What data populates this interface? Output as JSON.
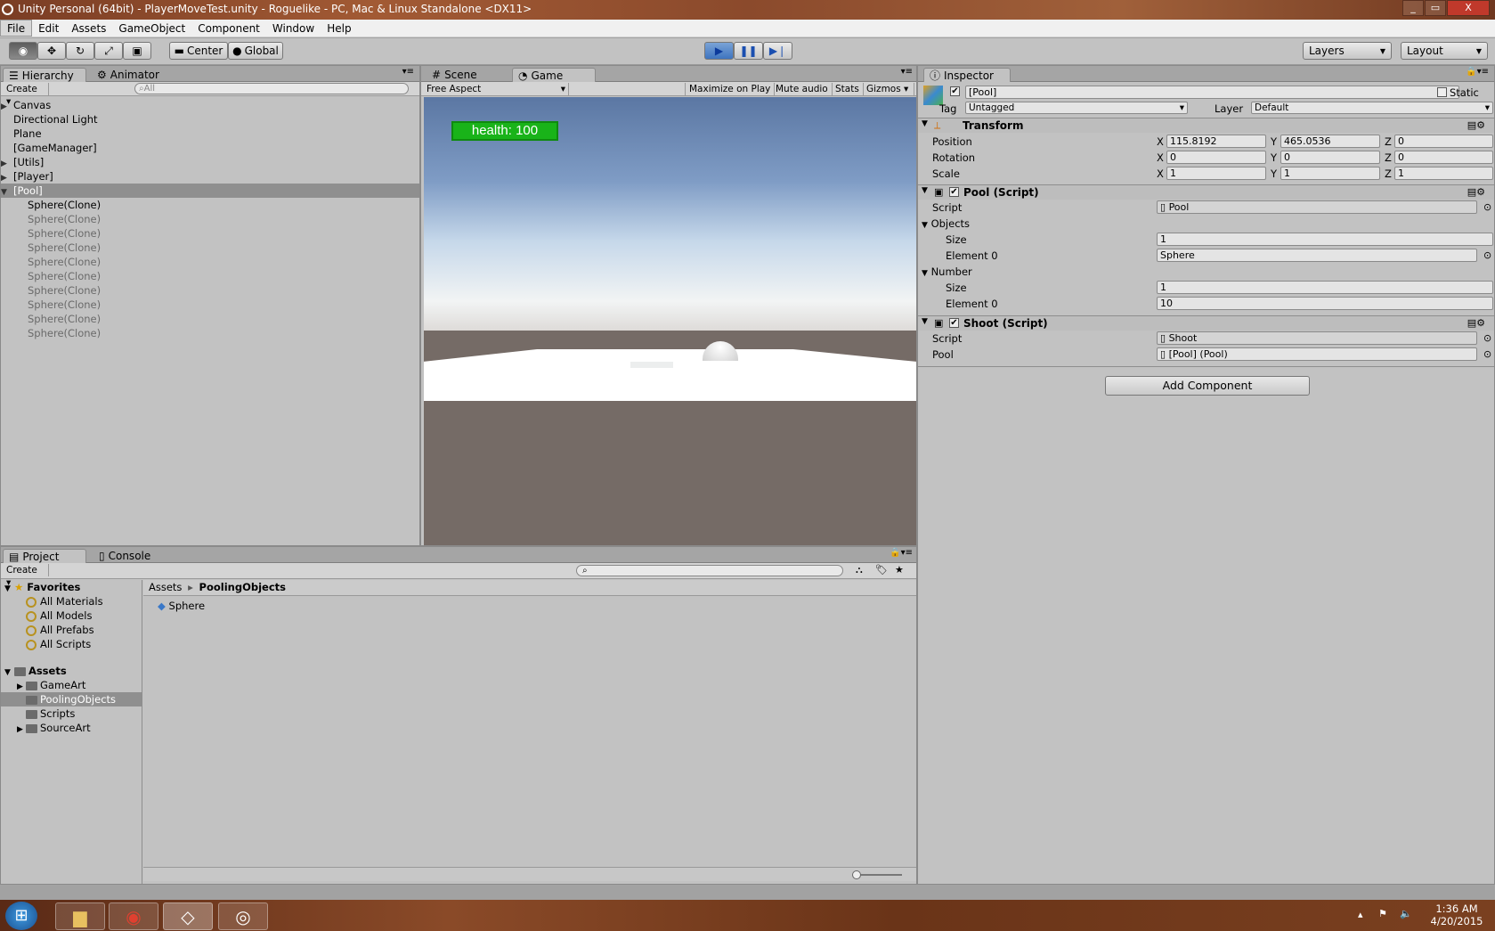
{
  "window": {
    "title": "Unity Personal (64bit) - PlayerMoveTest.unity - Roguelike - PC, Mac & Linux Standalone <DX11>",
    "minimize": "_",
    "maximize": "▭",
    "close": "X"
  },
  "menu": [
    "File",
    "Edit",
    "Assets",
    "GameObject",
    "Component",
    "Window",
    "Help"
  ],
  "toolbar": {
    "pivot": "Center",
    "space": "Global",
    "layers": "Layers",
    "layout": "Layout"
  },
  "hierarchy": {
    "tab": "Hierarchy",
    "tab2": "Animator",
    "create": "Create",
    "search_placeholder": "All",
    "items": [
      {
        "label": "Canvas",
        "expand": "▶"
      },
      {
        "label": "Directional Light",
        "expand": ""
      },
      {
        "label": "Plane",
        "expand": ""
      },
      {
        "label": "[GameManager]",
        "expand": ""
      },
      {
        "label": "[Utils]",
        "expand": "▶"
      },
      {
        "label": "[Player]",
        "expand": "▶"
      },
      {
        "label": "[Pool]",
        "expand": "▼"
      }
    ],
    "children": [
      "Sphere(Clone)",
      "Sphere(Clone)",
      "Sphere(Clone)",
      "Sphere(Clone)",
      "Sphere(Clone)",
      "Sphere(Clone)",
      "Sphere(Clone)",
      "Sphere(Clone)",
      "Sphere(Clone)",
      "Sphere(Clone)"
    ]
  },
  "game": {
    "tab_scene": "Scene",
    "tab_game": "Game",
    "aspect": "Free Aspect",
    "maximize": "Maximize on Play",
    "mute": "Mute audio",
    "stats": "Stats",
    "gizmos": "Gizmos",
    "health": "health: 100"
  },
  "inspector": {
    "tab": "Inspector",
    "object_name": "[Pool]",
    "static": "Static",
    "tag_label": "Tag",
    "tag_value": "Untagged",
    "layer_label": "Layer",
    "layer_value": "Default",
    "transform": {
      "title": "Transform",
      "rows": [
        {
          "label": "Position",
          "x": "115.8192",
          "y": "465.0536",
          "z": "0"
        },
        {
          "label": "Rotation",
          "x": "0",
          "y": "0",
          "z": "0"
        },
        {
          "label": "Scale",
          "x": "1",
          "y": "1",
          "z": "1"
        }
      ]
    },
    "pool": {
      "title": "Pool (Script)",
      "script_label": "Script",
      "script_value": "Pool",
      "objects_label": "Objects",
      "objects_size_label": "Size",
      "objects_size": "1",
      "objects_el_label": "Element 0",
      "objects_el": "Sphere",
      "number_label": "Number",
      "number_size_label": "Size",
      "number_size": "1",
      "number_el_label": "Element 0",
      "number_el": "10"
    },
    "shoot": {
      "title": "Shoot (Script)",
      "script_label": "Script",
      "script_value": "Shoot",
      "pool_label": "Pool",
      "pool_value": "[Pool] (Pool)"
    },
    "add_component": "Add Component"
  },
  "project": {
    "tab": "Project",
    "tab2": "Console",
    "create": "Create",
    "favorites": "Favorites",
    "fav_items": [
      "All Materials",
      "All Models",
      "All Prefabs",
      "All Scripts"
    ],
    "assets": "Assets",
    "asset_folders": [
      {
        "label": "GameArt",
        "expand": "▶"
      },
      {
        "label": "PoolingObjects",
        "expand": ""
      },
      {
        "label": "Scripts",
        "expand": ""
      },
      {
        "label": "SourceArt",
        "expand": "▶"
      }
    ],
    "breadcrumb_root": "Assets",
    "breadcrumb_sep": "▸",
    "breadcrumb_current": "PoolingObjects",
    "files": [
      "Sphere"
    ]
  },
  "taskbar": {
    "time": "1:36 AM",
    "date": "4/20/2015"
  }
}
